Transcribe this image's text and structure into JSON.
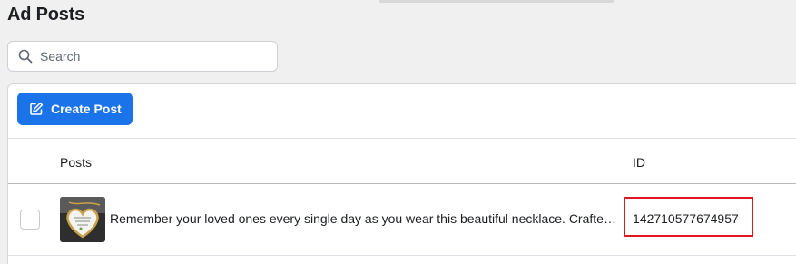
{
  "page": {
    "title": "Ad Posts"
  },
  "search": {
    "placeholder": "Search",
    "value": "",
    "icon": "search-icon"
  },
  "toolbar": {
    "create_label": "Create Post",
    "create_icon": "edit-icon",
    "accent": "#1a73e8"
  },
  "table": {
    "columns": [
      "Posts",
      "ID"
    ],
    "rows": [
      {
        "selected": false,
        "thumbnail": "heart-necklace-image",
        "text": "Remember your loved ones every single day as you wear this beautiful necklace. Crafted with care to keep their memory close to your heart.",
        "id": "142710577674957"
      }
    ]
  },
  "highlight": {
    "color": "#e0181e"
  }
}
